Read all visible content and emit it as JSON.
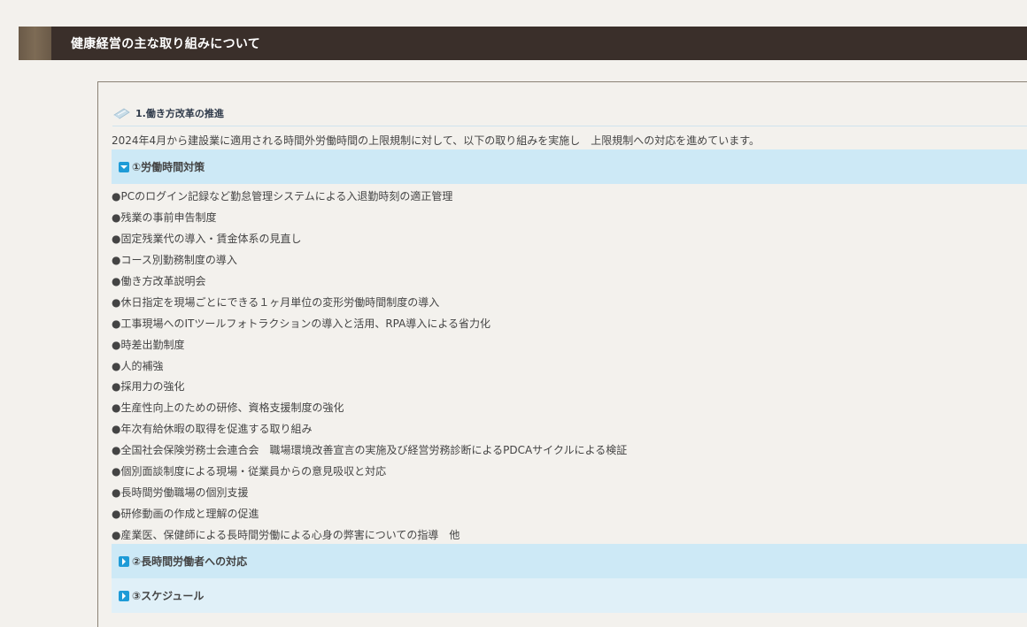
{
  "header": {
    "title": "健康経営の主な取り組みについて"
  },
  "section": {
    "title": "1.働き方改革の推進",
    "intro": "2024年4月から建設業に適用される時間外労働時間の上限規制に対して、以下の取り組みを実施し　上限規制への対応を進めています。"
  },
  "accordion": [
    {
      "label": "①労働時間対策",
      "state": "expanded"
    },
    {
      "label": "②長時間労働者への対応",
      "state": "collapsed"
    },
    {
      "label": "③スケジュール",
      "state": "collapsed"
    }
  ],
  "items": [
    "●PCのログイン記録など勤怠管理システムによる入退勤時刻の適正管理",
    "●残業の事前申告制度",
    "●固定残業代の導入・賃金体系の見直し",
    "●コース別勤務制度の導入",
    "●働き方改革説明会",
    "●休日指定を現場ごとにできる１ヶ月単位の変形労働時間制度の導入",
    "●工事現場へのITツールフォトラクションの導入と活用、RPA導入による省力化",
    "●時差出勤制度",
    "●人的補強",
    "●採用力の強化",
    "●生産性向上のための研修、資格支援制度の強化",
    "●年次有給休暇の取得を促進する取り組み",
    "●全国社会保険労務士会連合会　職場環境改善宣言の実施及び経営労務診断によるPDCAサイクルによる検証",
    "●個別面談制度による現場・従業員からの意見吸収と対応",
    "●長時間労働職場の個別支援",
    "●研修動画の作成と理解の促進",
    "●産業医、保健師による長時間労働による心身の弊害についての指導　他"
  ],
  "colors": {
    "header_bg": "#3a2f2a",
    "accordion_bg": "#cde9f6",
    "toggle_icon": "#1e9bd7"
  },
  "icons": {
    "section": "pencil-icon",
    "expanded": "chevron-down-icon",
    "collapsed": "chevron-right-icon"
  }
}
